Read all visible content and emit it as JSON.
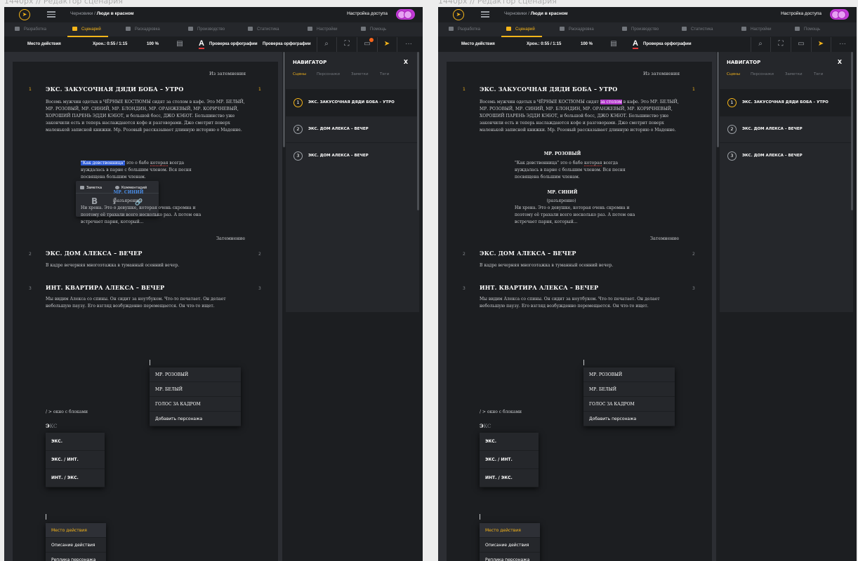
{
  "frame_title": "1440px // Редактор сценария",
  "topbar": {
    "breadcrumb_drafts": "Черновики",
    "breadcrumb_sep": " / ",
    "breadcrumb_project": "Люди в красном",
    "access_label": "Настройка доступа"
  },
  "tabs": [
    {
      "label": "Разработка"
    },
    {
      "label": "Сценарий"
    },
    {
      "label": "Раскадровка"
    },
    {
      "label": "Производство"
    },
    {
      "label": "Статистика"
    },
    {
      "label": "Настройки"
    },
    {
      "label": "Помощь"
    }
  ],
  "toolbar": {
    "block_type": "Место действия",
    "chron": "Хрон.: 0:55 / 1:15",
    "zoom": "100 %",
    "spell": "Проверка орфографии",
    "spell2": "Проверка орфографии"
  },
  "script": {
    "transition_top": "Из затемнения",
    "scene1_num": "1",
    "scene1_heading": "ЭКС. ЗАКУСОЧНАЯ ДЯДИ БОБА – УТРО",
    "action1_a": "Восемь мужчин одетых в ЧЁРНЫЕ КОСТЮМЫ сидят ",
    "action1_hl": "за столом",
    "action1_b": " в кафе. Это МР. БЕЛЫЙ, МР. РОЗОВЫЙ, МР. СИНИЙ, МР. БЛОНДИН, МР. ОРАНЖЕВЫЙ, МР. КОРИЧНЕВЫЙ, ХОРОШИЙ ПАРЕНЬ ЭДДИ КЭБОТ, и большой босс, ДЖО КЭБОТ. Большинство уже закончили есть и теперь наслаждаются кофе и разговорами. Джо смотрит поверх маленькой записной книжки. Мр. Розовый рассказывает длинную историю о Мадонне.",
    "char1": "МР. РОЗОВЫЙ",
    "dialog1_sel": "\"Как девственница\"",
    "dialog1_a": " это о бабе ",
    "dialog1_ul": "которая",
    "dialog1_b": " всегда нуждалась в парне с большим членом. Вся песня посвящена большим членам.",
    "char2": "МР. СИНИЙ",
    "paren2": "(разъяренно)",
    "dialog2": "Ни хрена. Это о девушке, которая очень скромна и поэтому её трахали всего несколько раз. А потом она встречает парня, который...",
    "transition_fade": "Затемнение",
    "scene2_num": "2",
    "scene2_heading": "ЭКС. ДОМ АЛЕКСА – ВЕЧЕР",
    "action2": "В кадре вечерняя многоэтажка в туманный осенний вечер.",
    "scene3_num": "3",
    "scene3_heading": "ИНТ. КВАРТИРА АЛЕКСА – ВЕЧЕР",
    "action3": "Мы видим Алекса со спины. Он сидит за ноутбуком. Что-то печатает. Он делает небольшую паузу. Его взгляд возбужденно перемещается. Он что-то ищет.",
    "slash_hint": "/ > окно с блоками",
    "typed_prefix": "Э",
    "typed_rest": "КС"
  },
  "format_popup": {
    "note": "Заметка",
    "comment": "Комментарий",
    "bold": "B",
    "italic": "I",
    "link": "🔗"
  },
  "character_menu": [
    "МР. РОЗОВЫЙ",
    "МР. БЕЛЫЙ",
    "ГОЛОС ЗА КАДРОМ",
    "Добавить персонажа"
  ],
  "scene_menu": [
    "ЭКС.",
    "ЭКС. / ИНТ.",
    "ИНТ. / ЭКС."
  ],
  "block_menu": [
    "Место действия",
    "Описание действия",
    "Реплика персонажа"
  ],
  "navigator": {
    "title": "НАВИГАТОР",
    "close": "X",
    "tabs": [
      "Сцены",
      "Персонажи",
      "Заметки",
      "Теги"
    ],
    "items": [
      {
        "num": "1",
        "label": "ЭКС. ЗАКУСОЧНАЯ ДЯДИ БОБА – УТРО"
      },
      {
        "num": "2",
        "label": "ЭКС. ДОМ АЛЕКСА – ВЕЧЕР"
      },
      {
        "num": "3",
        "label": "ЭКС. ДОМ АЛЕКСА – ВЕЧЕР"
      }
    ]
  },
  "colors": {
    "accent": "#f6b51a",
    "toggle": "#c23ad6",
    "selection": "#2c5bd7",
    "highlight": "#b135c9"
  }
}
